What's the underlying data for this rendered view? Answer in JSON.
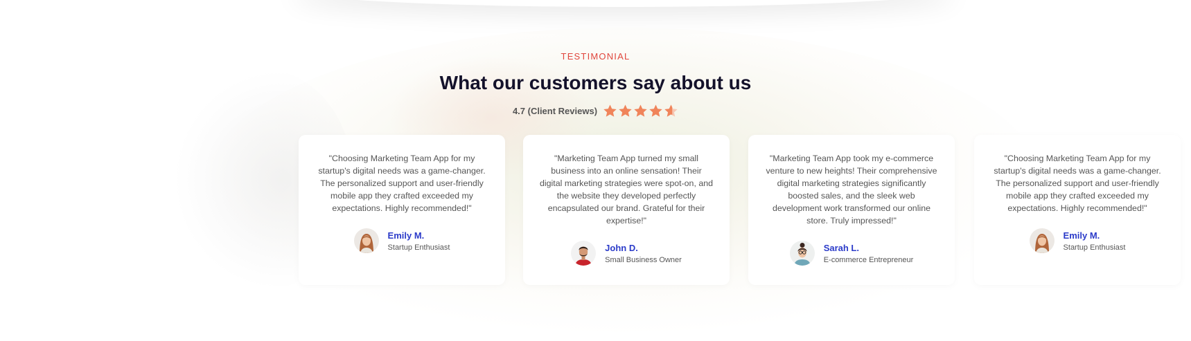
{
  "section": {
    "eyebrow": "TESTIMONIAL",
    "title": "What our customers say about us",
    "rating_text": "4.7 (Client Reviews)",
    "rating_value": 4.7,
    "rating_max": 5,
    "star_color": "#f0845a"
  },
  "colors": {
    "eyebrow": "#e0453c",
    "title": "#14122b",
    "author_name": "#2b3bc9",
    "body_text": "#555555"
  },
  "testimonials": [
    {
      "quote": "\"Choosing Marketing Team App for my startup's digital needs was a game-changer. The personalized support and user-friendly mobile app they crafted exceeded my expectations. Highly recommended!\"",
      "name": "Emily M.",
      "role": "Startup Enthusiast",
      "avatar_icon": "woman-avatar"
    },
    {
      "quote": "\"Marketing Team App turned my small business into an online sensation! Their digital marketing strategies were spot-on, and the website they developed perfectly encapsulated our brand. Grateful for their expertise!\"",
      "name": "John D.",
      "role": "Small Business Owner",
      "avatar_icon": "man-avatar"
    },
    {
      "quote": "\"Marketing Team App took my e-commerce venture to new heights! Their comprehensive digital marketing strategies significantly boosted sales, and the sleek web development work transformed our online store. Truly impressed!\"",
      "name": "Sarah L.",
      "role": "E-commerce Entrepreneur",
      "avatar_icon": "woman-glasses-avatar"
    },
    {
      "quote": "\"Choosing Marketing Team App for my startup's digital needs was a game-changer. The personalized support and user-friendly mobile app they crafted exceeded my expectations. Highly recommended!\"",
      "name": "Emily M.",
      "role": "Startup Enthusiast",
      "avatar_icon": "woman-avatar"
    }
  ]
}
